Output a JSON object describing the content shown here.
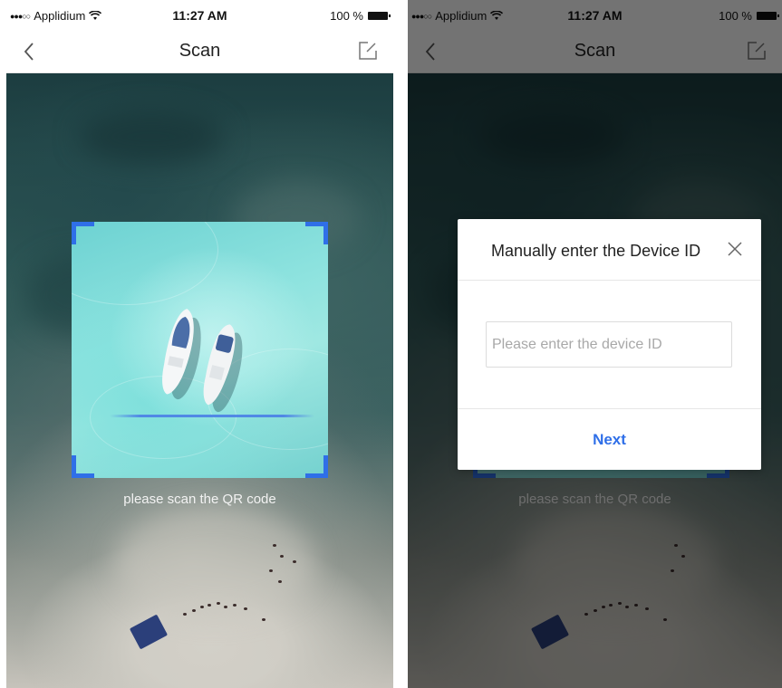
{
  "status_bar": {
    "carrier": "Applidium",
    "time": "11:27 AM",
    "battery": "100 %"
  },
  "nav": {
    "title": "Scan",
    "back_icon": "chevron-left-icon",
    "right_icon": "edit-icon"
  },
  "scanner": {
    "hint": "please scan the QR code",
    "corner_color": "#2f6fe8"
  },
  "modal": {
    "title": "Manually enter the Device ID",
    "input_placeholder": "Please enter the device ID",
    "input_value": "",
    "next_label": "Next",
    "close_icon": "close-icon",
    "accent_color": "#2f6fe8"
  }
}
